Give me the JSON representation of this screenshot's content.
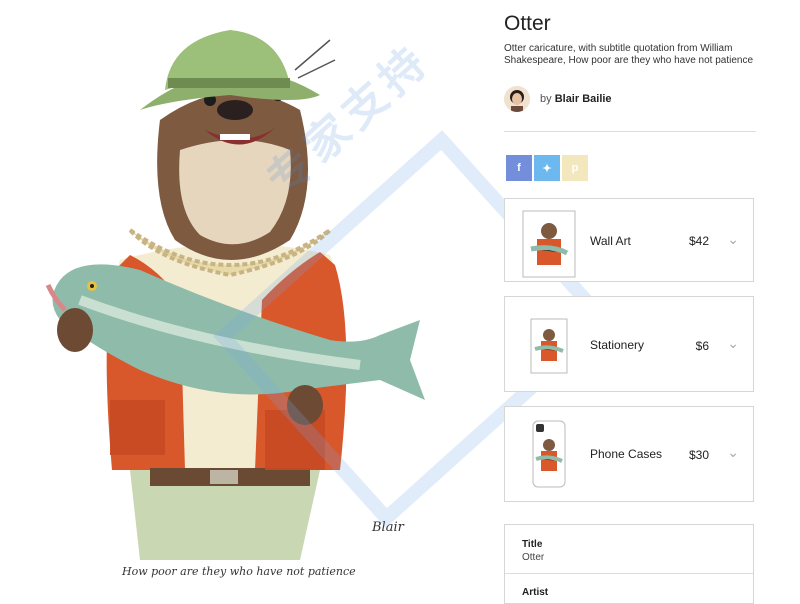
{
  "product": {
    "title": "Otter",
    "description": "Otter caricature, with subtitle quotation from William Shakespeare, How poor are they who have not patience",
    "by_label": "by",
    "artist": "Blair Bailie"
  },
  "artwork": {
    "caption": "How poor are they who have not patience",
    "signature": "Blair"
  },
  "share": [
    {
      "icon": "facebook-icon",
      "glyph": "f",
      "color": "#3b5998"
    },
    {
      "icon": "twitter-icon",
      "glyph": "t",
      "color": "#1da1f2"
    },
    {
      "icon": "pinterest-icon",
      "glyph": "p",
      "color": "#e8c77a"
    }
  ],
  "products": [
    {
      "label": "Wall Art",
      "price": "$42"
    },
    {
      "label": "Stationery",
      "price": "$6"
    },
    {
      "label": "Phone Cases",
      "price": "$30"
    }
  ],
  "details": {
    "title_key": "Title",
    "title_value": "Otter",
    "artist_key": "Artist"
  },
  "watermark": "专家支持"
}
